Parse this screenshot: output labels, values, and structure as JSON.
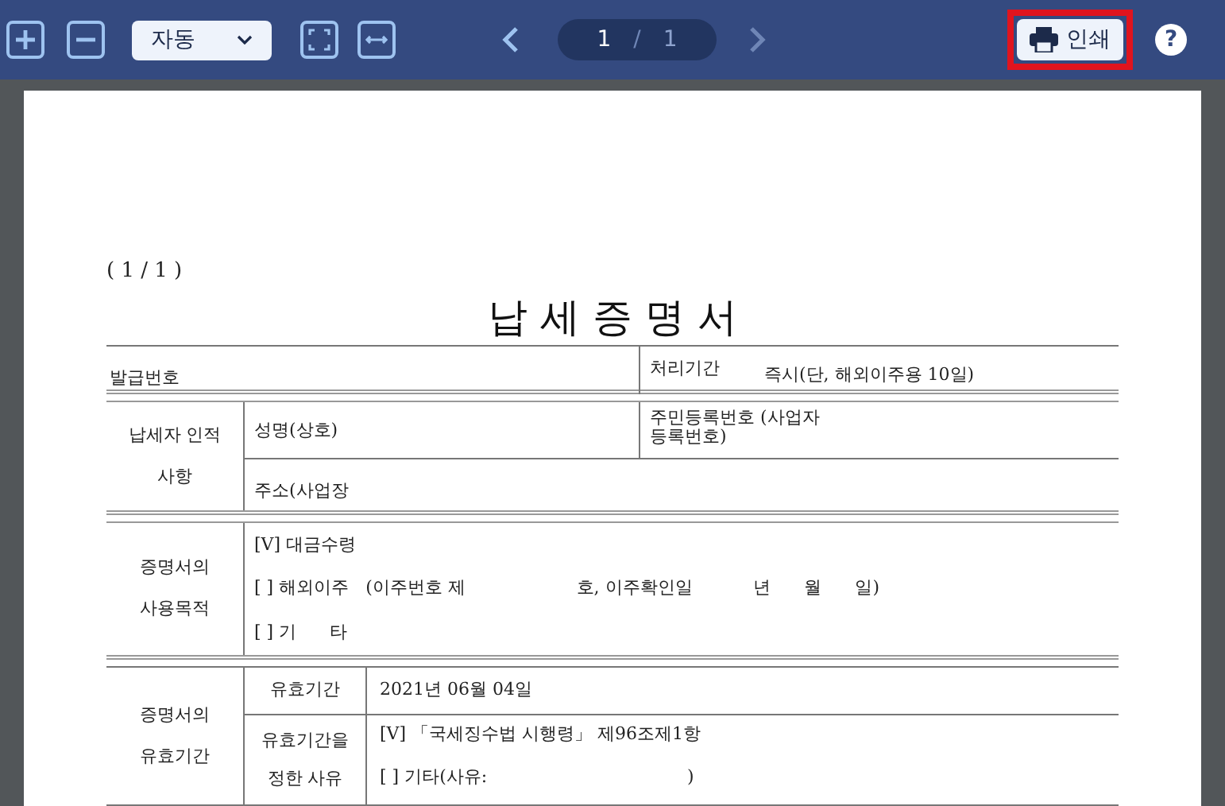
{
  "toolbar": {
    "zoom_select": "자동",
    "page_current": "1",
    "page_separator": "/",
    "page_total": "1",
    "print_button": "인쇄",
    "help_button": "?"
  },
  "document": {
    "page_counter": "( 1 / 1 )",
    "title": "납 세 증 명 서",
    "issue_row": {
      "issue_number_label": "발급번호",
      "processing_label": "처리기간",
      "processing_value": "즉시(단, 해외이주용 10일)"
    },
    "taxpayer": {
      "section_label": "납세자 인적사항",
      "name_label": "성명(상호)",
      "id_label": "주민등록번호 (사업자등록번호)",
      "address_label": "주소(사업장"
    },
    "purpose": {
      "section_label": "증명서의 사용목적",
      "options": [
        {
          "mark": "[V]",
          "text": "대금수령"
        },
        {
          "mark": "[ ]",
          "text": "해외이주   (이주번호 제                    호, 이주확인일           년      월      일)"
        },
        {
          "mark": "[ ]",
          "text": "기      타"
        }
      ]
    },
    "validity": {
      "section_label": "증명서의 유효기간",
      "period_label": "유효기간",
      "period_value": "2021년 06월 04일",
      "reason_label": "유효기간을 정한 사유",
      "reasons": [
        {
          "mark": "[V]",
          "text": "「국세징수법 시행령」 제96조제1항"
        },
        {
          "mark": "[ ]",
          "text": "기타(사유:                                    )"
        }
      ]
    }
  }
}
